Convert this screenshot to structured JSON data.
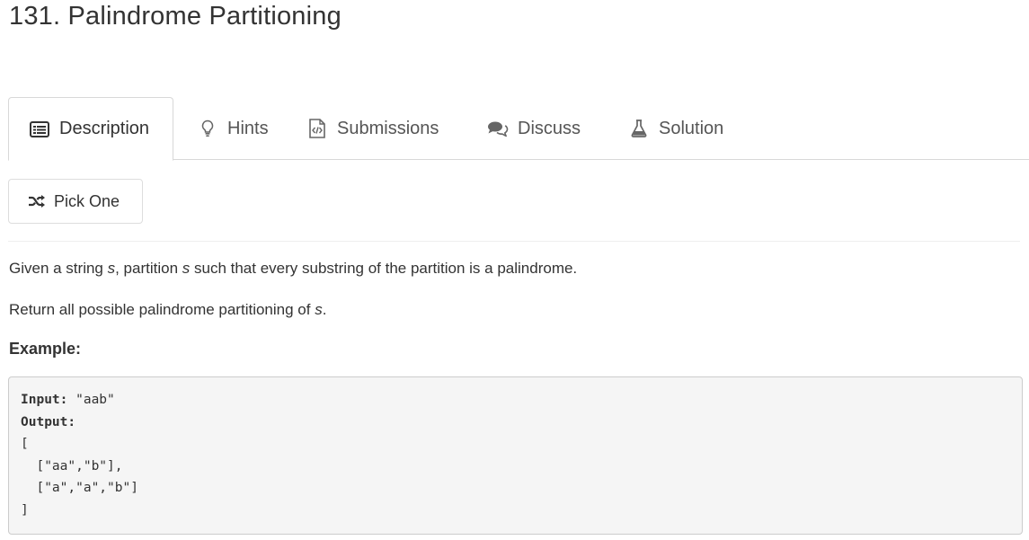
{
  "problem": {
    "title": "131. Palindrome Partitioning"
  },
  "tabs": [
    {
      "label": "Description",
      "icon": "list-alt-icon",
      "active": true
    },
    {
      "label": "Hints",
      "icon": "lightbulb-icon",
      "active": false
    },
    {
      "label": "Submissions",
      "icon": "code-file-icon",
      "active": false
    },
    {
      "label": "Discuss",
      "icon": "comments-icon",
      "active": false
    },
    {
      "label": "Solution",
      "icon": "flask-icon",
      "active": false
    }
  ],
  "pick_one": {
    "label": "Pick One",
    "icon": "shuffle-icon"
  },
  "description": {
    "line1": {
      "a": "Given a string ",
      "b": "s",
      "c": ", partition ",
      "d": "s",
      "e": " such that every substring of the partition is a palindrome."
    },
    "line2": {
      "a": "Return all possible palindrome partitioning of ",
      "b": "s",
      "c": "."
    },
    "example_heading": "Example:",
    "example": {
      "input_label": "Input:",
      "input_value": " \"aab\"",
      "output_label": "Output:",
      "output_lines": [
        "[",
        "  [\"aa\",\"b\"],",
        "  [\"a\",\"a\",\"b\"]",
        "]"
      ]
    }
  },
  "colors": {
    "text": "#333333",
    "tab_text": "#555555",
    "border": "#d8d8d8",
    "code_bg": "#f5f5f5"
  }
}
